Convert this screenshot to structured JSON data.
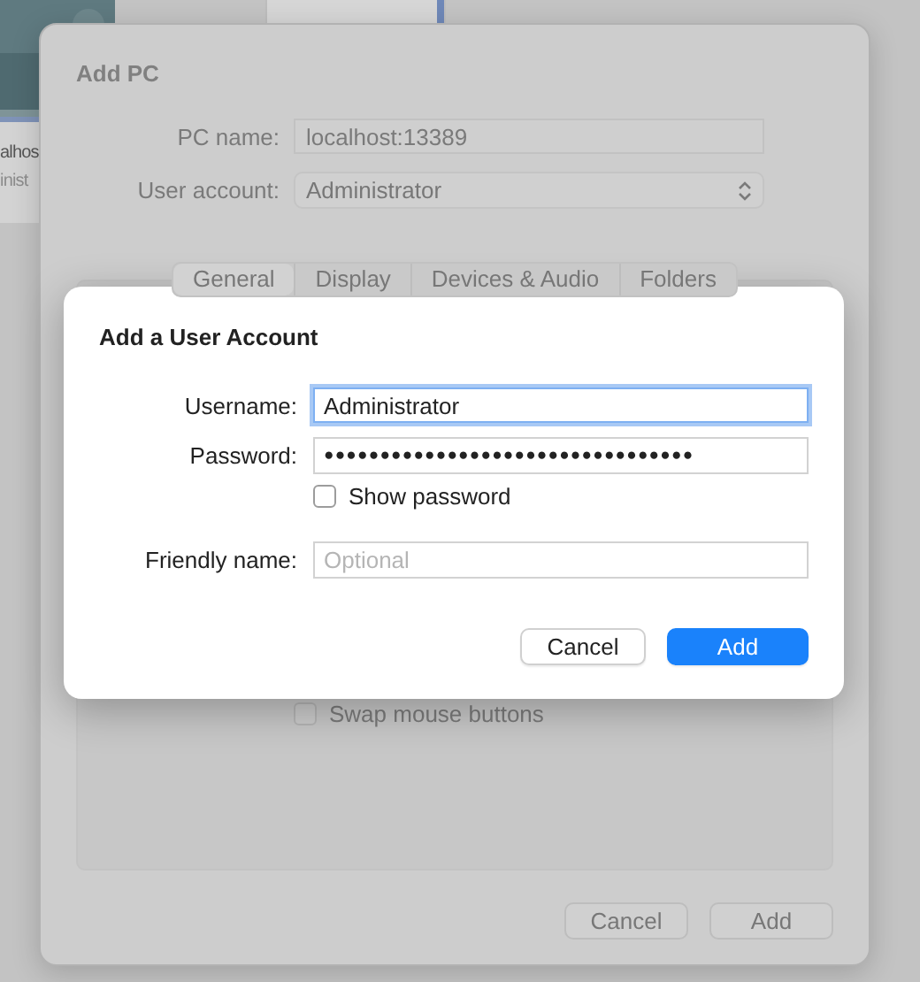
{
  "background_window": {
    "texts": [
      "alhos",
      "inist"
    ]
  },
  "sheet": {
    "title": "Add PC",
    "fields": [
      {
        "label": "PC name:",
        "kind": "text",
        "value": "localhost:13389"
      },
      {
        "label": "User account:",
        "kind": "popup",
        "value": "Administrator"
      }
    ],
    "tabs": [
      {
        "label": "General",
        "selected": true
      },
      {
        "label": "Display",
        "selected": false
      },
      {
        "label": "Devices & Audio",
        "selected": false
      },
      {
        "label": "Folders",
        "selected": false
      }
    ],
    "options": [
      {
        "label": "Swap mouse buttons",
        "checked": false
      }
    ],
    "buttons": [
      {
        "label": "Cancel",
        "kind": "normal"
      },
      {
        "label": "Add",
        "kind": "normal"
      }
    ]
  },
  "dialog": {
    "title": "Add a User Account",
    "fields": [
      {
        "label": "Username:",
        "kind": "text",
        "value": "Administrator",
        "focused": true
      },
      {
        "label": "Password:",
        "kind": "password",
        "value": "●●●●●●●●●●●●●●●●●●●●●●●●●●●●●●●●●",
        "focused": false
      },
      {
        "label": "Show password",
        "kind": "checkbox",
        "checked": false
      },
      {
        "label": "Friendly name:",
        "kind": "text",
        "placeholder": "Optional",
        "focused": false
      }
    ],
    "buttons": [
      {
        "label": "Cancel",
        "kind": "normal"
      },
      {
        "label": "Add",
        "kind": "primary"
      }
    ]
  }
}
